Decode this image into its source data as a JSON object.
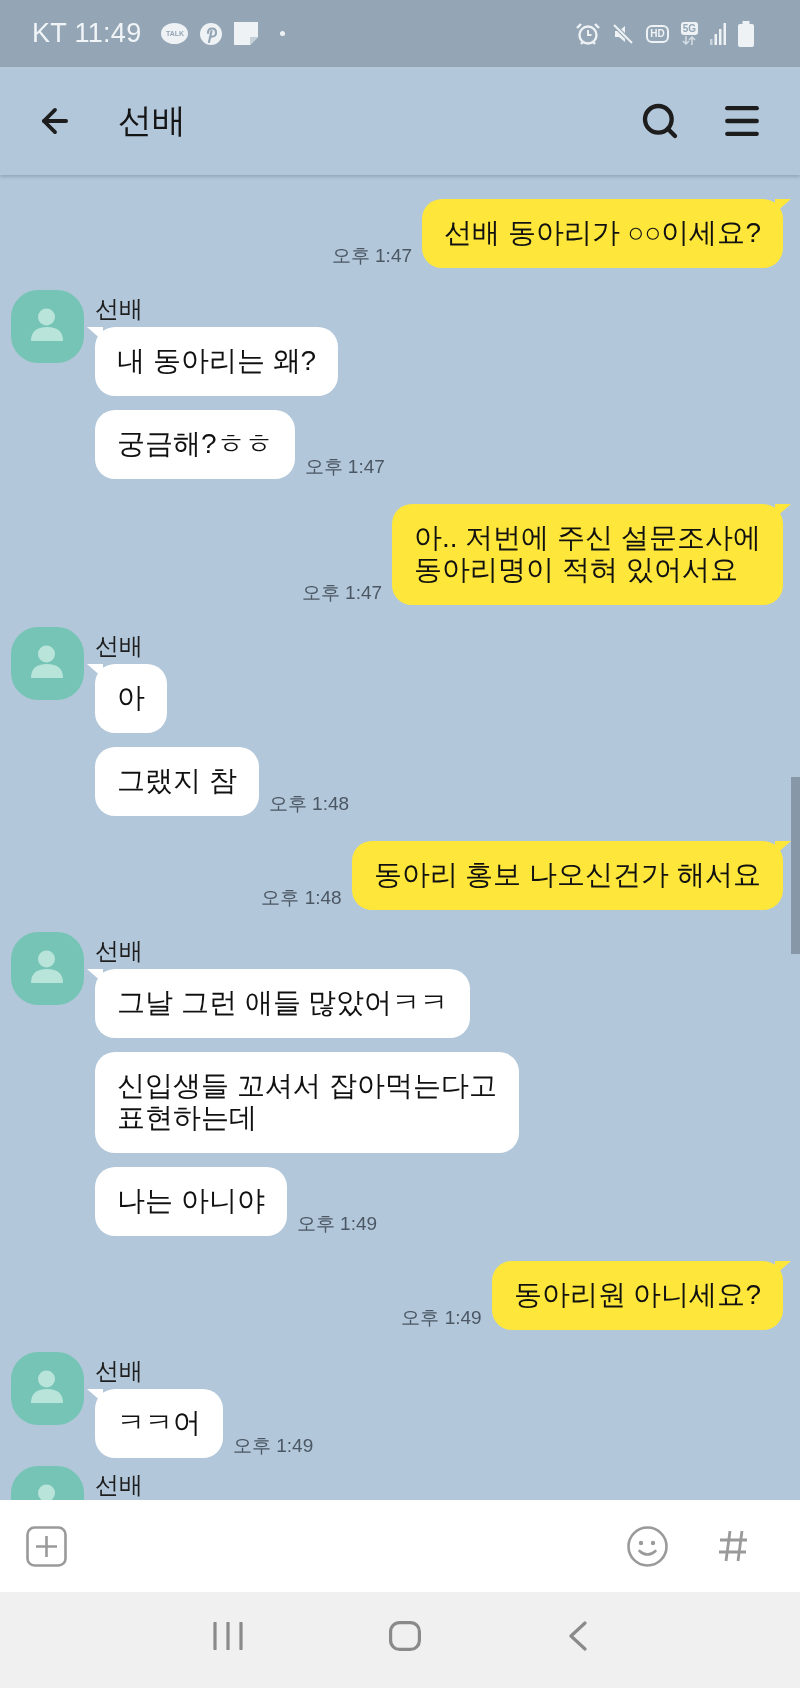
{
  "status_bar": {
    "carrier_time": "KT 11:49",
    "talk_badge": "TALK",
    "hd_badge": "HD",
    "network_badge": "5G"
  },
  "header": {
    "title": "선배"
  },
  "messages": [
    {
      "kind": "sent",
      "bubbles": [
        "선배 동아리가 ○○이세요?"
      ],
      "time": "오후 1:47"
    },
    {
      "kind": "received",
      "sender": "선배",
      "bubbles": [
        "내 동아리는 왜?",
        "궁금해?ㅎㅎ"
      ],
      "time": "오후 1:47"
    },
    {
      "kind": "sent",
      "bubbles": [
        "아.. 저번에 주신 설문조사에\n동아리명이 적혀 있어서요"
      ],
      "time": "오후 1:47"
    },
    {
      "kind": "received",
      "sender": "선배",
      "bubbles": [
        "아",
        "그랬지 참"
      ],
      "time": "오후 1:48"
    },
    {
      "kind": "sent",
      "bubbles": [
        "동아리 홍보 나오신건가 해서요"
      ],
      "time": "오후 1:48"
    },
    {
      "kind": "received",
      "sender": "선배",
      "bubbles": [
        "그날 그런 애들 많았어ㅋㅋ",
        "신입생들 꼬셔서 잡아먹는다고\n표현하는데",
        "나는 아니야"
      ],
      "time": "오후 1:49"
    },
    {
      "kind": "sent",
      "bubbles": [
        "동아리원 아니세요?"
      ],
      "time": "오후 1:49"
    },
    {
      "kind": "received",
      "sender": "선배",
      "bubbles": [
        "ㅋㅋ어"
      ],
      "time": "오후 1:49"
    },
    {
      "kind": "received",
      "sender": "선배"
    }
  ]
}
